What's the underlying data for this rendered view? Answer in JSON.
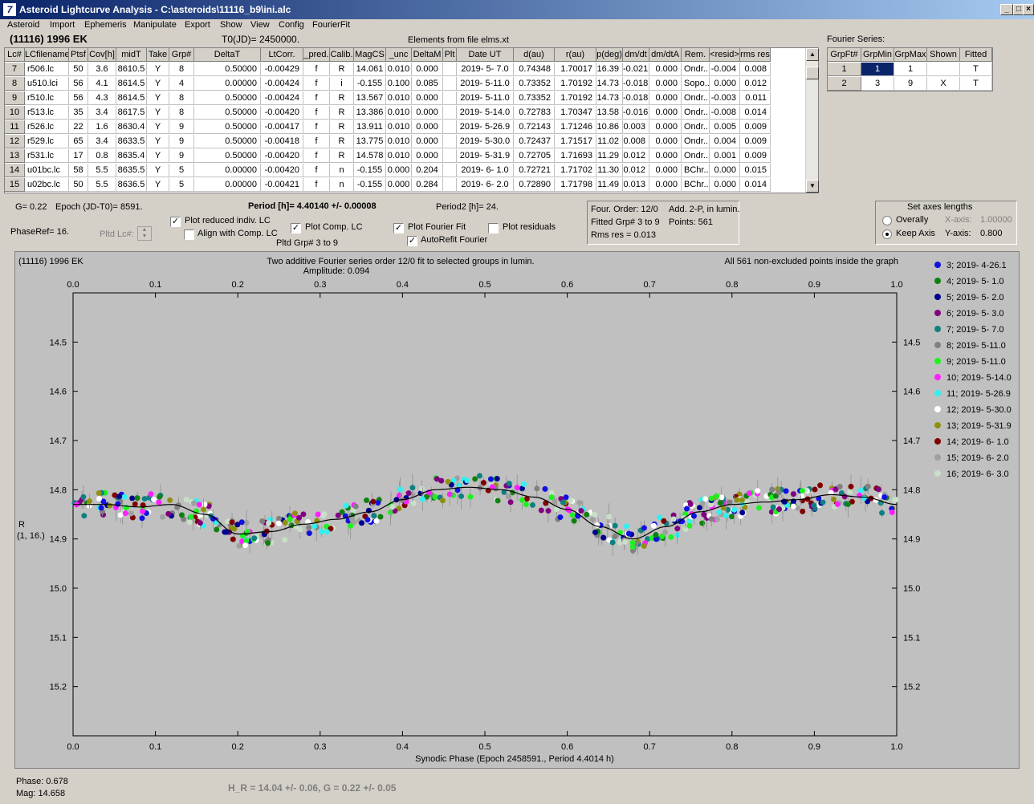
{
  "window": {
    "title": "Asteroid Lightcurve Analysis - C:\\asteroids\\11116_b9\\ini.alc",
    "app_icon": "7"
  },
  "menu": [
    "Asteroid",
    "Import",
    "Ephemeris",
    "Manipulate",
    "Export",
    "Show",
    "View",
    "Config",
    "FourierFit"
  ],
  "header": {
    "object": "(11116) 1996 EK",
    "t0": "T0(JD)= 2450000.",
    "elements": "Elements from file elms.xt"
  },
  "lc_table": {
    "columns": [
      "Lc#",
      "LCfilename",
      "Ptsf",
      "Cov[h]",
      "midT",
      "Take",
      "Grp#",
      "DeltaT",
      "LtCorr.",
      "_pred.",
      "Calib.",
      "MagCS",
      "_unc",
      "DeltaM",
      "Plt",
      "Date UT",
      "d(au)",
      "r(au)",
      "p(deg)",
      "dm/dt",
      "dm/dtA",
      "Rem.",
      "<resid>",
      "rms res"
    ],
    "rows": [
      [
        "7",
        "r506.lc",
        "50",
        "3.6",
        "8610.5",
        "Y",
        "8",
        "0.50000",
        "-0.00429",
        "f",
        "R",
        "14.061",
        "0.010",
        "0.000",
        "",
        "2019- 5- 7.0",
        "0.74348",
        "1.70017",
        "16.39",
        "-0.021",
        "0.000",
        "Ondr...",
        "-0.004",
        "0.008"
      ],
      [
        "8",
        "u510.lci",
        "56",
        "4.1",
        "8614.5",
        "Y",
        "4",
        "0.00000",
        "-0.00424",
        "f",
        "i",
        "-0.155",
        "0.100",
        "0.085",
        "",
        "2019- 5-11.0",
        "0.73352",
        "1.70192",
        "14.73",
        "-0.018",
        "0.000",
        "Sopo...",
        "0.000",
        "0.012"
      ],
      [
        "9",
        "r510.lc",
        "56",
        "4.3",
        "8614.5",
        "Y",
        "8",
        "0.50000",
        "-0.00424",
        "f",
        "R",
        "13.567",
        "0.010",
        "0.000",
        "",
        "2019- 5-11.0",
        "0.73352",
        "1.70192",
        "14.73",
        "-0.018",
        "0.000",
        "Ondr...",
        "-0.003",
        "0.011"
      ],
      [
        "10",
        "r513.lc",
        "35",
        "3.4",
        "8617.5",
        "Y",
        "8",
        "0.50000",
        "-0.00420",
        "f",
        "R",
        "13.386",
        "0.010",
        "0.000",
        "",
        "2019- 5-14.0",
        "0.72783",
        "1.70347",
        "13.58",
        "-0.016",
        "0.000",
        "Ondr...",
        "-0.008",
        "0.014"
      ],
      [
        "11",
        "r526.lc",
        "22",
        "1.6",
        "8630.4",
        "Y",
        "9",
        "0.50000",
        "-0.00417",
        "f",
        "R",
        "13.911",
        "0.010",
        "0.000",
        "",
        "2019- 5-26.9",
        "0.72143",
        "1.71246",
        "10.86",
        "0.003",
        "0.000",
        "Ondr...",
        "0.005",
        "0.009"
      ],
      [
        "12",
        "r529.lc",
        "65",
        "3.4",
        "8633.5",
        "Y",
        "9",
        "0.50000",
        "-0.00418",
        "f",
        "R",
        "13.775",
        "0.010",
        "0.000",
        "",
        "2019- 5-30.0",
        "0.72437",
        "1.71517",
        "11.02",
        "0.008",
        "0.000",
        "Ondr...",
        "0.004",
        "0.009"
      ],
      [
        "13",
        "r531.lc",
        "17",
        "0.8",
        "8635.4",
        "Y",
        "9",
        "0.50000",
        "-0.00420",
        "f",
        "R",
        "14.578",
        "0.010",
        "0.000",
        "",
        "2019- 5-31.9",
        "0.72705",
        "1.71693",
        "11.29",
        "0.012",
        "0.000",
        "Ondr...",
        "0.001",
        "0.009"
      ],
      [
        "14",
        "u01bc.lc",
        "58",
        "5.5",
        "8635.5",
        "Y",
        "5",
        "0.00000",
        "-0.00420",
        "f",
        "n",
        "-0.155",
        "0.000",
        "0.204",
        "",
        "2019- 6- 1.0",
        "0.72721",
        "1.71702",
        "11.30",
        "0.012",
        "0.000",
        "BChr...",
        "0.000",
        "0.015"
      ],
      [
        "15",
        "u02bc.lc",
        "50",
        "5.5",
        "8636.5",
        "Y",
        "5",
        "0.00000",
        "-0.00421",
        "f",
        "n",
        "-0.155",
        "0.000",
        "0.284",
        "",
        "2019- 6- 2.0",
        "0.72890",
        "1.71798",
        "11.49",
        "0.013",
        "0.000",
        "BChr...",
        "0.000",
        "0.014"
      ]
    ]
  },
  "fourier_series": {
    "title": "Fourier Series:",
    "columns": [
      "GrpFt#",
      "GrpMin",
      "GrpMax",
      "Shown",
      "Fitted"
    ],
    "rows": [
      [
        "1",
        "1",
        "1",
        "",
        "T"
      ],
      [
        "2",
        "3",
        "9",
        "X",
        "T"
      ]
    ]
  },
  "params": {
    "g": "G= 0.22",
    "epoch": "Epoch (JD-T0)= 8591.",
    "period": "Period [h]= 4.40140 +/- 0.00008",
    "period2": "Period2 [h]= 24.",
    "phaseref": "PhaseRef= 16.",
    "pltd_lc": "Pltd Lc#:",
    "pltd_grp": "Pltd Grp#  3  to  9"
  },
  "checkboxes": {
    "plot_reduced": {
      "label": "Plot reduced indiv. LC",
      "checked": "✓"
    },
    "align_comp": {
      "label": "Align with Comp. LC",
      "checked": ""
    },
    "plot_comp": {
      "label": "Plot Comp. LC",
      "checked": "✓"
    },
    "plot_fourier": {
      "label": "Plot Fourier Fit",
      "checked": "✓"
    },
    "autorefit": {
      "label": "AutoRefit Fourier",
      "checked": "✓"
    },
    "plot_resid": {
      "label": "Plot residuals",
      "checked": ""
    }
  },
  "fit_info": {
    "order": "Four. Order: 12/0",
    "add": "Add. 2-P, in lumin.",
    "fitted": "Fitted Grp# 3 to 9",
    "points": "Points: 561",
    "rms": "Rms res     = 0.013"
  },
  "axes_panel": {
    "title": "Set axes lengths",
    "overally": "Overally",
    "keep": "Keep Axis",
    "xaxis_label": "X-axis:",
    "xaxis_val": "1.00000",
    "yaxis_label": "Y-axis:",
    "yaxis_val": "0.800"
  },
  "colors": {
    "accent": "#0a246a",
    "plot_bg": "#c0c0c0"
  },
  "chart_data": {
    "type": "scatter",
    "title": "(11116) 1996 EK",
    "subtitle": "Two additive Fourier series order 12/0 fit to selected groups in lumin.",
    "amplitude": "Amplitude: 0.094",
    "note": "All 561 non-excluded points inside the graph",
    "xlabel": "Synodic Phase (Epoch 2458591., Period 4.4014 h)",
    "ylabel": "R",
    "ylabel2": "(1, 16.)",
    "xlim": [
      0.0,
      1.0
    ],
    "ylim": [
      14.4,
      15.3
    ],
    "xticks": [
      "0.0",
      "0.1",
      "0.2",
      "0.3",
      "0.4",
      "0.5",
      "0.6",
      "0.7",
      "0.8",
      "0.9",
      "1.0"
    ],
    "yticks": [
      "14.5",
      "14.6",
      "14.7",
      "14.8",
      "14.9",
      "15.0",
      "15.1",
      "15.2"
    ],
    "fit_curve": {
      "x": [
        0.0,
        0.04,
        0.08,
        0.12,
        0.16,
        0.2,
        0.24,
        0.28,
        0.32,
        0.36,
        0.4,
        0.44,
        0.48,
        0.52,
        0.56,
        0.6,
        0.64,
        0.68,
        0.72,
        0.76,
        0.8,
        0.84,
        0.88,
        0.92,
        0.96,
        1.0
      ],
      "y": [
        14.83,
        14.83,
        14.835,
        14.83,
        14.85,
        14.89,
        14.885,
        14.87,
        14.86,
        14.845,
        14.82,
        14.8,
        14.795,
        14.8,
        14.815,
        14.84,
        14.875,
        14.9,
        14.875,
        14.845,
        14.83,
        14.825,
        14.82,
        14.81,
        14.815,
        14.83
      ]
    },
    "series": [
      {
        "name": "3; 2019- 4-26.1",
        "color": "#1010e0"
      },
      {
        "name": "4; 2019- 5- 1.0",
        "color": "#108010"
      },
      {
        "name": "5; 2019- 5- 2.0",
        "color": "#000090"
      },
      {
        "name": "6; 2019- 5- 3.0",
        "color": "#800080"
      },
      {
        "name": "7; 2019- 5- 7.0",
        "color": "#108080"
      },
      {
        "name": "8; 2019- 5-11.0",
        "color": "#808080"
      },
      {
        "name": "9; 2019- 5-11.0",
        "color": "#20f020"
      },
      {
        "name": "10; 2019- 5-14.0",
        "color": "#ff20ff"
      },
      {
        "name": "11; 2019- 5-26.9",
        "color": "#30f0f0"
      },
      {
        "name": "12; 2019- 5-30.0",
        "color": "#ffffff"
      },
      {
        "name": "13; 2019- 5-31.9",
        "color": "#909010"
      },
      {
        "name": "14; 2019- 6- 1.0",
        "color": "#800000"
      },
      {
        "name": "15; 2019- 6- 2.0",
        "color": "#a0a0a0"
      },
      {
        "name": "16; 2019- 6- 3.0",
        "color": "#c8e0c8"
      }
    ]
  },
  "status": {
    "phase": "Phase:  0.678",
    "mag": "Mag:    14.658",
    "hg": "H_R = 14.04 +/- 0.06, G = 0.22 +/- 0.05"
  }
}
